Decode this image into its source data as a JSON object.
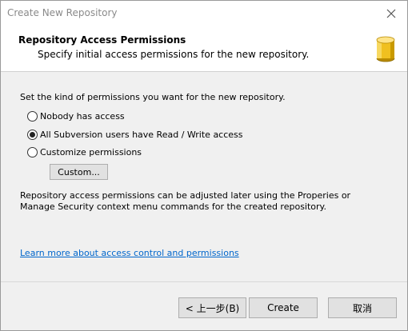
{
  "window": {
    "title": "Create New Repository"
  },
  "header": {
    "title": "Repository Access Permissions",
    "subtitle": "Specify initial access permissions for the new repository."
  },
  "permissions": {
    "intro": "Set the kind of permissions you want for the new repository.",
    "options": [
      {
        "label": "Nobody has access",
        "selected": false
      },
      {
        "label": "All Subversion users have Read / Write access",
        "selected": true
      },
      {
        "label": "Customize permissions",
        "selected": false
      }
    ],
    "custom_button": "Custom...",
    "note": "Repository access permissions can be adjusted later using the Properies or Manage Security context menu commands for the created repository.",
    "learn_more_link": "Learn more about access control and permissions"
  },
  "footer": {
    "back_button": "< 上一步(B)",
    "create_button": "Create",
    "cancel_button": "取消"
  },
  "colors": {
    "link": "#0066cc",
    "db_icon": "#e8b400"
  }
}
